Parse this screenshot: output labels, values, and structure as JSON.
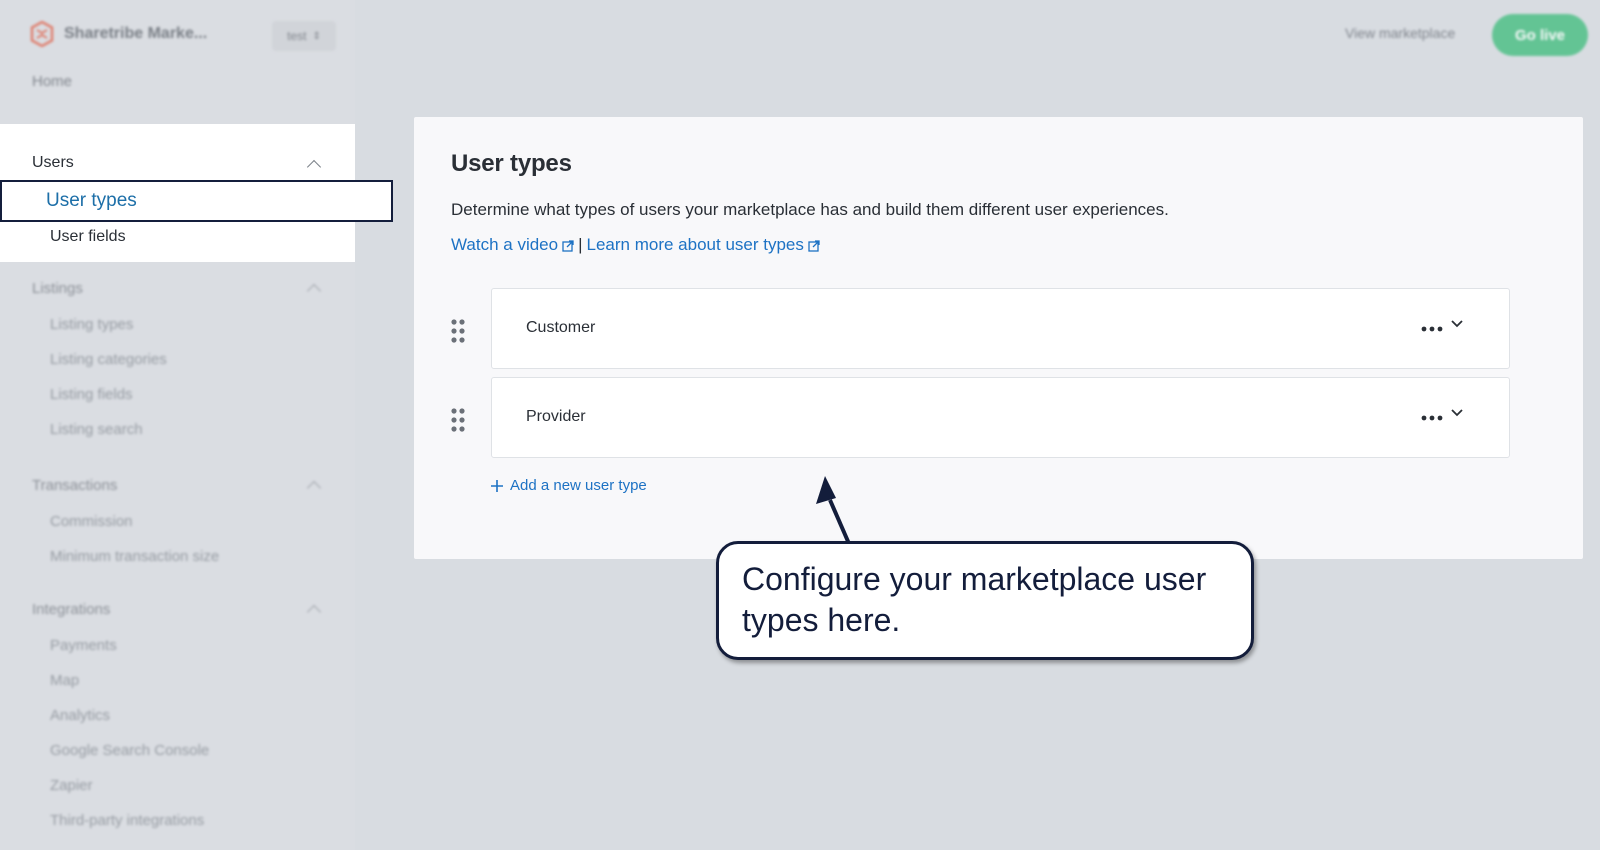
{
  "brand": {
    "name": "Sharetribe Marke...",
    "logo_icon": "sharetribe-logo-icon"
  },
  "environment": {
    "label": "test"
  },
  "topbar": {
    "view_marketplace": "View marketplace",
    "go_live": "Go live",
    "accent": "#4fc087"
  },
  "sidebar": {
    "home": "Home",
    "users": {
      "title": "Users",
      "items": [
        {
          "label": "User types",
          "selected": true
        },
        {
          "label": "User fields",
          "selected": false
        }
      ]
    },
    "listings": {
      "title": "Listings",
      "items": [
        "Listing types",
        "Listing categories",
        "Listing fields",
        "Listing search"
      ]
    },
    "transactions": {
      "title": "Transactions",
      "items": [
        "Commission",
        "Minimum transaction size"
      ]
    },
    "integrations": {
      "title": "Integrations",
      "items": [
        "Payments",
        "Map",
        "Analytics",
        "Google Search Console",
        "Zapier",
        "Third-party integrations"
      ]
    }
  },
  "main": {
    "title": "User types",
    "description": "Determine what types of users your marketplace has and build them different user experiences.",
    "links": {
      "video": "Watch a video",
      "separator": "|",
      "learn_more": "Learn more about user types"
    },
    "user_types": [
      {
        "name": "Customer"
      },
      {
        "name": "Provider"
      }
    ],
    "add_label": "Add a new user type"
  },
  "callout": {
    "text": "Configure your marketplace user types here."
  },
  "colors": {
    "link": "#1d72c4",
    "selected": "#1d6fa8",
    "outline": "#141e3c"
  }
}
